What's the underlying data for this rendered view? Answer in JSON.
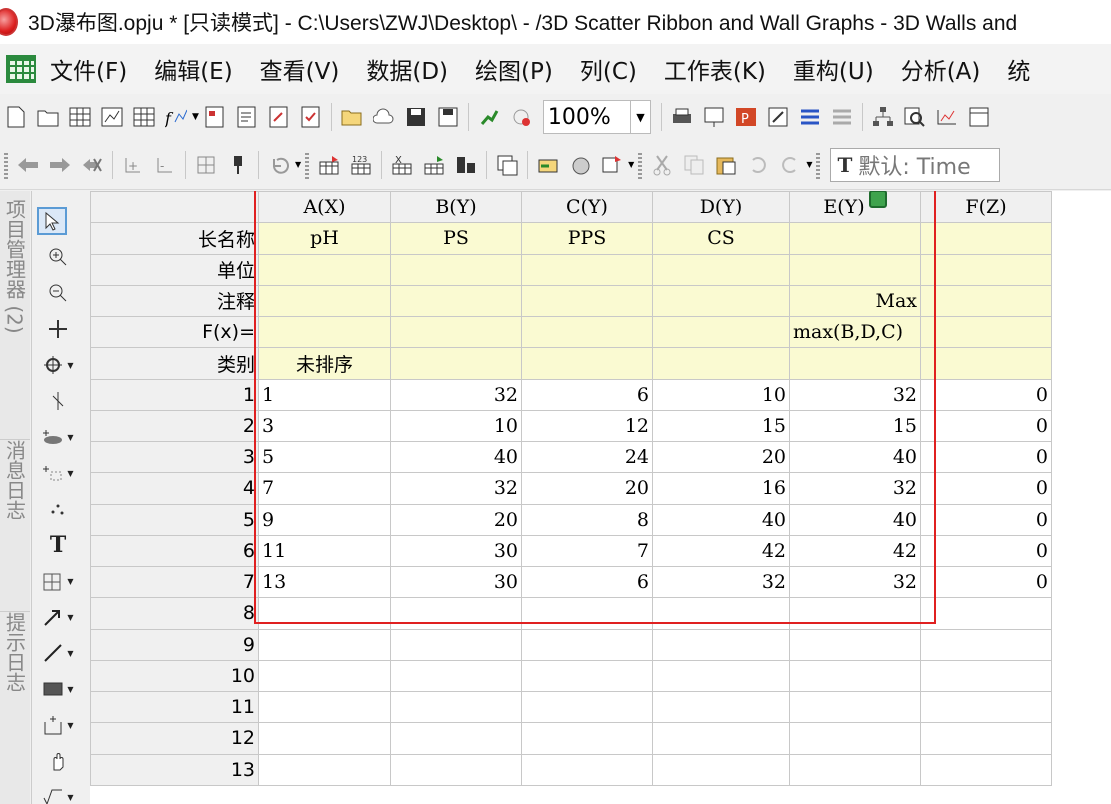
{
  "window": {
    "title": "3D瀑布图.opju * [只读模式] - C:\\Users\\ZWJ\\Desktop\\ - /3D Scatter Ribbon and Wall Graphs - 3D Walls and"
  },
  "menu": [
    "文件(F)",
    "编辑(E)",
    "查看(V)",
    "数据(D)",
    "绘图(P)",
    "列(C)",
    "工作表(K)",
    "重构(U)",
    "分析(A)",
    "统"
  ],
  "toolbar": {
    "zoom_value": "100%",
    "font_placeholder": "默认: Time",
    "font_icon_glyph": "T"
  },
  "side_tabs": [
    "项目管理器 (2)",
    "消息日志",
    "提示日志"
  ],
  "sheet": {
    "columns": [
      "A(X)",
      "B(Y)",
      "C(Y)",
      "D(Y)",
      "E(Y)",
      "F(Z)"
    ],
    "meta_labels": [
      "长名称",
      "单位",
      "注释",
      "F(x)=",
      "类别"
    ],
    "long_names": [
      "pH",
      "PS",
      "PPS",
      "CS",
      "",
      ""
    ],
    "comments": [
      "",
      "",
      "",
      "",
      "Max",
      ""
    ],
    "formulas": [
      "",
      "",
      "",
      "",
      "max(B,D,C)",
      ""
    ],
    "category": [
      "未排序",
      "",
      "",
      "",
      "",
      ""
    ],
    "row_numbers": [
      "1",
      "2",
      "3",
      "4",
      "5",
      "6",
      "7",
      "8",
      "9",
      "10",
      "11",
      "12",
      "13"
    ],
    "rows": [
      [
        "1",
        "32",
        "6",
        "10",
        "32",
        "0"
      ],
      [
        "3",
        "10",
        "12",
        "15",
        "15",
        "0"
      ],
      [
        "5",
        "40",
        "24",
        "20",
        "40",
        "0"
      ],
      [
        "7",
        "32",
        "20",
        "16",
        "32",
        "0"
      ],
      [
        "9",
        "20",
        "8",
        "40",
        "40",
        "0"
      ],
      [
        "11",
        "30",
        "7",
        "42",
        "42",
        "0"
      ],
      [
        "13",
        "30",
        "6",
        "32",
        "32",
        "0"
      ]
    ]
  },
  "colors": {
    "meta_bg": "#fafad2",
    "highlight": "#e02020",
    "lock_icon": "#3fa34d"
  }
}
